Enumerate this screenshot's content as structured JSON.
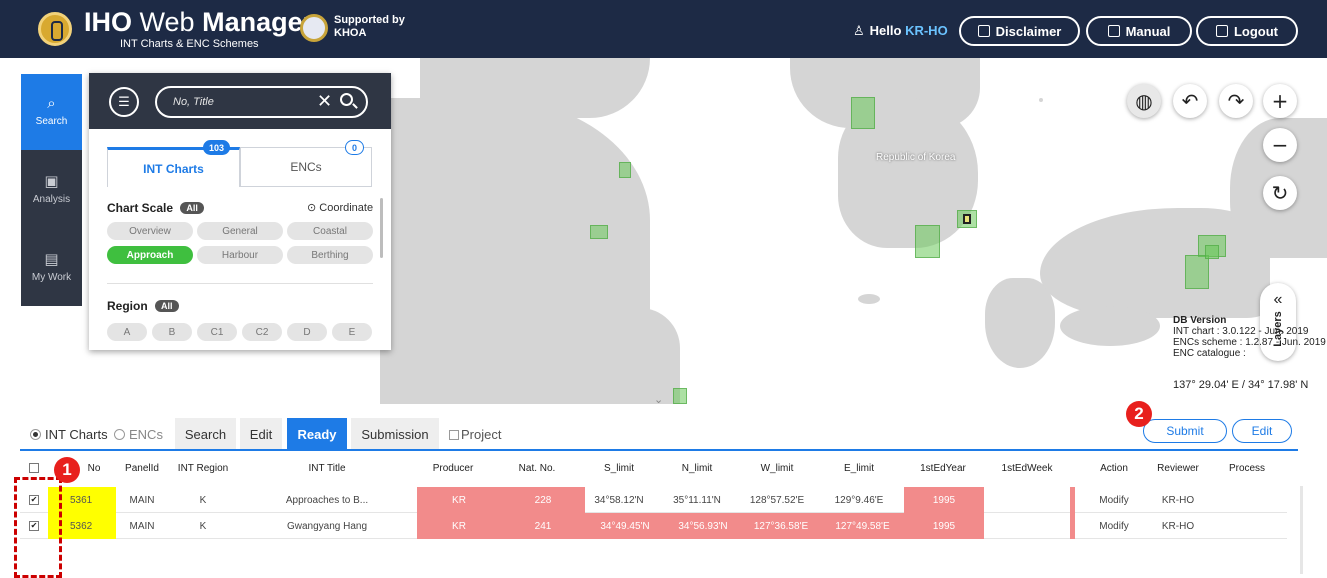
{
  "header": {
    "brand_bold": "IHO",
    "brand_light": "Web",
    "brand_bold2": "Manager",
    "subtitle": "INT Charts & ENC Schemes",
    "supported_line1": "Supported by",
    "supported_line2": "KHOA",
    "hello_label": "Hello",
    "hello_user": "KR-HO",
    "disclaimer": "Disclaimer",
    "manual": "Manual",
    "logout": "Logout"
  },
  "rail": {
    "search": "Search",
    "analysis": "Analysis",
    "mywork": "My Work"
  },
  "panel": {
    "search_placeholder": "No, Title",
    "tab_int": "INT Charts",
    "tab_enc": "ENCs",
    "count_int": "103",
    "count_enc": "0",
    "chart_scale_label": "Chart Scale",
    "all_label": "All",
    "coordinate": "Coordinate",
    "scales": [
      "Overview",
      "General",
      "Coastal",
      "Approach",
      "Harbour",
      "Berthing"
    ],
    "region_label": "Region",
    "regions": [
      "A",
      "B",
      "C1",
      "C2",
      "D",
      "E"
    ]
  },
  "map": {
    "country_label": "Republic of Korea",
    "layers_label": "Layers",
    "db_version_title": "DB Version",
    "db_int": "INT chart : 3.0.122 - Jun. 2019",
    "db_enc_scheme": "ENCs scheme : 1.2.87 - Jun. 2019",
    "db_enc_catalogue": "ENC catalogue :",
    "coordinates": "137° 29.04' E  /  34° 17.98' N"
  },
  "subbar": {
    "radio_int": "INT Charts",
    "radio_enc": "ENCs",
    "tabs": [
      "Search",
      "Edit",
      "Ready",
      "Submission"
    ],
    "project": "Project",
    "submit": "Submit",
    "edit": "Edit"
  },
  "table": {
    "headers": [
      "No",
      "PanelId",
      "INT Region",
      "INT Title",
      "Producer",
      "Nat. No.",
      "S_limit",
      "N_limit",
      "W_limit",
      "E_limit",
      "1stEdYear",
      "1stEdWeek",
      "Action",
      "Reviewer",
      "Process"
    ],
    "rows": [
      {
        "no": "5361",
        "panel": "MAIN",
        "region": "K",
        "title": "Approaches to B...",
        "producer": "KR",
        "natno": "228",
        "s": "34°58.12'N",
        "n": "35°11.11'N",
        "w": "128°57.52'E",
        "e": "129°9.46'E",
        "year": "1995",
        "week": "",
        "action": "Modify",
        "reviewer": "KR-HO",
        "process": ""
      },
      {
        "no": "5362",
        "panel": "MAIN",
        "region": "K",
        "title": "Gwangyang Hang",
        "producer": "KR",
        "natno": "241",
        "s": "34°49.45'N",
        "n": "34°56.93'N",
        "w": "127°36.58'E",
        "e": "127°49.58'E",
        "year": "1995",
        "week": "",
        "action": "Modify",
        "reviewer": "KR-HO",
        "process": ""
      }
    ]
  },
  "annotations": {
    "badge1": "1",
    "badge2": "2"
  }
}
